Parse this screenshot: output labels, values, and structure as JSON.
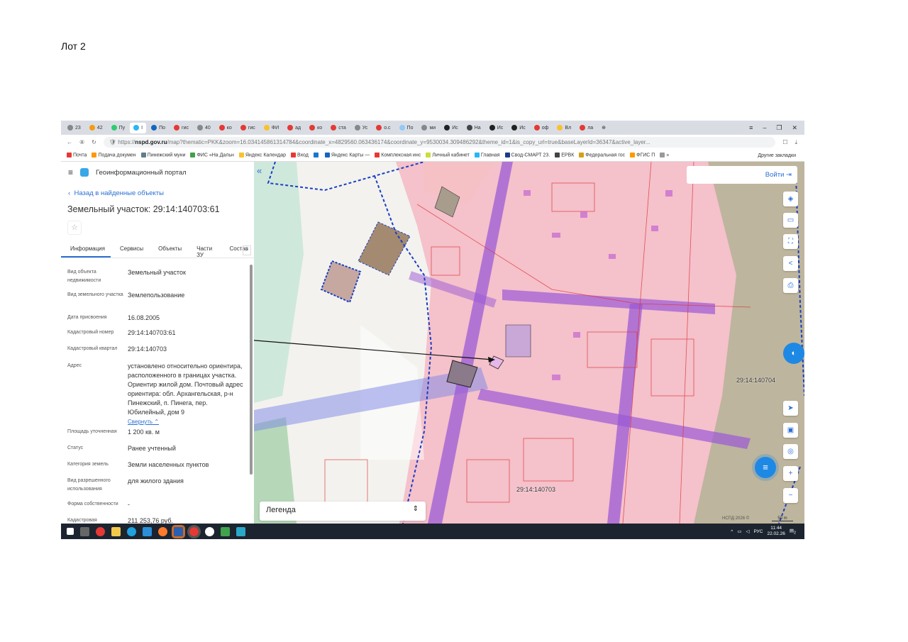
{
  "doc": {
    "heading": "Лот 2"
  },
  "browser": {
    "tabs": [
      "23",
      "42",
      "Пу",
      "I",
      "По",
      "гис",
      "40",
      "ко",
      "гис",
      "ФИ",
      "ад",
      "ко",
      "ста",
      "Ус",
      "о.с",
      "По",
      "ми",
      "Ис",
      "На",
      "Ис",
      "Ис",
      "оф",
      "Вл",
      "ла"
    ],
    "active_tab_index": 3,
    "url_host": "nspd.gov.ru",
    "url_prefix": "https://",
    "url_rest": "/map?thematic=PKK&zoom=16.034145861314784&coordinate_x=4829560.063436174&coordinate_y=9530034.309486292&theme_id=1&is_copy_url=true&baseLayerId=36347&active_layer...",
    "bookmarks": [
      "Почта",
      "Подача докумен",
      "Пинежский муни",
      "ФИС «На Дальн",
      "Яндекс Календар",
      "Вход",
      "",
      "Яндекс Карты —",
      "Комплексная инс",
      "Личный кабинет",
      "Главная",
      "Свод-СМАРТ 23.",
      "ЕРВК",
      "Федеральная гос",
      "ФГИС П",
      "»"
    ],
    "bookmark_colors": [
      "#e53935",
      "#ff9800",
      "#607d8b",
      "#43a047",
      "#fbc02d",
      "#e53935",
      "#1976d2",
      "#1565c0",
      "#e53935",
      "#cddc39",
      "#29b6f6",
      "#1e3a8a",
      "#444",
      "#d4a017",
      "#ff9800",
      "#999",
      "#777"
    ],
    "other_bookmarks": "Другие закладки"
  },
  "portal": {
    "name": "Геоинформационный портал",
    "back": "Назад в найденные объекты",
    "title": "Земельный участок: 29:14:140703:61",
    "tabs": [
      "Информация",
      "Сервисы",
      "Объекты",
      "Части ЗУ",
      "Состав"
    ],
    "fields": [
      {
        "k": "Вид объекта недвижимости",
        "v": "Земельный участок"
      },
      {
        "k": "Вид земельного участка",
        "v": "Землепользование"
      },
      {
        "k": "Дата присвоения",
        "v": "16.08.2005"
      },
      {
        "k": "Кадастровый номер",
        "v": "29:14:140703:61"
      },
      {
        "k": "Кадастровый квартал",
        "v": "29:14:140703"
      },
      {
        "k": "Адрес",
        "v": "установлено относительно ориентира, расположенного в границах участка. Ориентир жилой дом. Почтовый адрес ориентира: обл. Архангельская, р-н Пинежский, п. Пинега, пер. Юбилейный, дом 9"
      },
      {
        "k": "Площадь уточненная",
        "v": "1 200 кв. м"
      },
      {
        "k": "Статус",
        "v": "Ранее учтенный"
      },
      {
        "k": "Категория земель",
        "v": "Земли населенных пунктов"
      },
      {
        "k": "Вид разрешенного использования",
        "v": "для жилого здания"
      },
      {
        "k": "Форма собственности",
        "v": "-"
      },
      {
        "k": "Кадастровая",
        "v": "211 253,76 руб."
      }
    ],
    "collapse": "Свернуть"
  },
  "map": {
    "login": "Войти",
    "legend": "Легенда",
    "quarter_labels": [
      "29:14:140704",
      "29:14:140703"
    ],
    "copyright": "НСПД 2026 ©",
    "scale": "50 m",
    "controls": [
      "layers-icon",
      "ruler-icon",
      "select-area-icon",
      "share-icon",
      "print-icon",
      "locate-icon",
      "picture-in-picture-icon",
      "search-location-icon",
      "zoom-in-icon",
      "zoom-out-icon"
    ],
    "colors": {
      "zone": "#f4b8c4",
      "accent": "#2b6fd6",
      "utility": "#9b59d6",
      "boundary": "#1a3fc2"
    }
  },
  "taskbar": {
    "lang": "РУС",
    "time": "11:44",
    "date": "22.02.26",
    "notif": "2"
  }
}
